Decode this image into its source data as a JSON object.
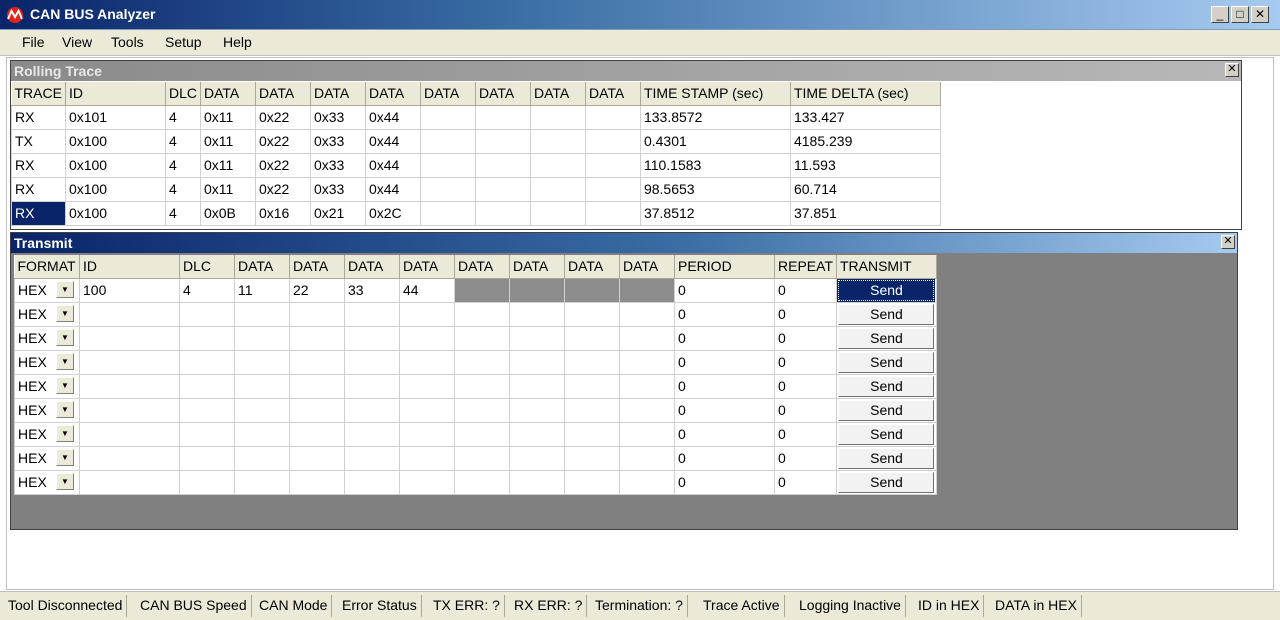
{
  "window": {
    "title": "CAN BUS Analyzer",
    "controls": {
      "minimize": "_",
      "maximize": "□",
      "close": "✕"
    }
  },
  "menu": [
    "File",
    "View",
    "Tools",
    "Setup",
    "Help"
  ],
  "rolling_trace": {
    "title": "Rolling Trace",
    "close": "✕",
    "columns": [
      "TRACE",
      "ID",
      "DLC",
      "DATA",
      "DATA",
      "DATA",
      "DATA",
      "DATA",
      "DATA",
      "DATA",
      "DATA",
      "TIME STAMP (sec)",
      "TIME DELTA (sec)"
    ],
    "rows": [
      [
        "RX",
        "0x101",
        "4",
        "0x11",
        "0x22",
        "0x33",
        "0x44",
        "",
        "",
        "",
        "",
        "133.8572",
        "133.427"
      ],
      [
        "TX",
        "0x100",
        "4",
        "0x11",
        "0x22",
        "0x33",
        "0x44",
        "",
        "",
        "",
        "",
        "0.4301",
        "4185.239"
      ],
      [
        "RX",
        "0x100",
        "4",
        "0x11",
        "0x22",
        "0x33",
        "0x44",
        "",
        "",
        "",
        "",
        "110.1583",
        "11.593"
      ],
      [
        "RX",
        "0x100",
        "4",
        "0x11",
        "0x22",
        "0x33",
        "0x44",
        "",
        "",
        "",
        "",
        "98.5653",
        "60.714"
      ],
      [
        "RX",
        "0x100",
        "4",
        "0x0B",
        "0x16",
        "0x21",
        "0x2C",
        "",
        "",
        "",
        "",
        "37.8512",
        "37.851"
      ]
    ],
    "selected_row": 4
  },
  "transmit": {
    "title": "Transmit",
    "close": "✕",
    "columns": [
      "FORMAT",
      "ID",
      "DLC",
      "DATA",
      "DATA",
      "DATA",
      "DATA",
      "DATA",
      "DATA",
      "DATA",
      "DATA",
      "PERIOD",
      "REPEAT",
      "TRANSMIT"
    ],
    "combo_arrow": "▼",
    "rows": [
      {
        "format": "HEX",
        "id": "100",
        "dlc": "4",
        "data": [
          "11",
          "22",
          "33",
          "44",
          "",
          "",
          "",
          ""
        ],
        "data_disabled_from": 4,
        "period": "0",
        "repeat": "0",
        "button": "Send"
      },
      {
        "format": "HEX",
        "id": "",
        "dlc": "",
        "data": [
          "",
          "",
          "",
          "",
          "",
          "",
          "",
          ""
        ],
        "data_disabled_from": 8,
        "period": "0",
        "repeat": "0",
        "button": "Send"
      },
      {
        "format": "HEX",
        "id": "",
        "dlc": "",
        "data": [
          "",
          "",
          "",
          "",
          "",
          "",
          "",
          ""
        ],
        "data_disabled_from": 8,
        "period": "0",
        "repeat": "0",
        "button": "Send"
      },
      {
        "format": "HEX",
        "id": "",
        "dlc": "",
        "data": [
          "",
          "",
          "",
          "",
          "",
          "",
          "",
          ""
        ],
        "data_disabled_from": 8,
        "period": "0",
        "repeat": "0",
        "button": "Send"
      },
      {
        "format": "HEX",
        "id": "",
        "dlc": "",
        "data": [
          "",
          "",
          "",
          "",
          "",
          "",
          "",
          ""
        ],
        "data_disabled_from": 8,
        "period": "0",
        "repeat": "0",
        "button": "Send"
      },
      {
        "format": "HEX",
        "id": "",
        "dlc": "",
        "data": [
          "",
          "",
          "",
          "",
          "",
          "",
          "",
          ""
        ],
        "data_disabled_from": 8,
        "period": "0",
        "repeat": "0",
        "button": "Send"
      },
      {
        "format": "HEX",
        "id": "",
        "dlc": "",
        "data": [
          "",
          "",
          "",
          "",
          "",
          "",
          "",
          ""
        ],
        "data_disabled_from": 8,
        "period": "0",
        "repeat": "0",
        "button": "Send"
      },
      {
        "format": "HEX",
        "id": "",
        "dlc": "",
        "data": [
          "",
          "",
          "",
          "",
          "",
          "",
          "",
          ""
        ],
        "data_disabled_from": 8,
        "period": "0",
        "repeat": "0",
        "button": "Send"
      },
      {
        "format": "HEX",
        "id": "",
        "dlc": "",
        "data": [
          "",
          "",
          "",
          "",
          "",
          "",
          "",
          ""
        ],
        "data_disabled_from": 8,
        "period": "0",
        "repeat": "0",
        "button": "Send"
      }
    ],
    "active_button_row": 0
  },
  "status_bar": [
    "Tool Disconnected",
    "CAN BUS Speed",
    "CAN Mode",
    "Error Status",
    "TX ERR: ?",
    "RX ERR: ?",
    "Termination: ?",
    "Trace Active",
    "Logging Inactive",
    "ID in HEX",
    "DATA in HEX"
  ],
  "colors": {
    "title_gradient_start": "#0a246a",
    "title_gradient_end": "#a6caf0",
    "selection": "#0a246a",
    "panel_bg": "#808080",
    "disabled_cell": "#8c8c8c"
  },
  "icons": {
    "app_logo": "microchip-logo-icon"
  }
}
